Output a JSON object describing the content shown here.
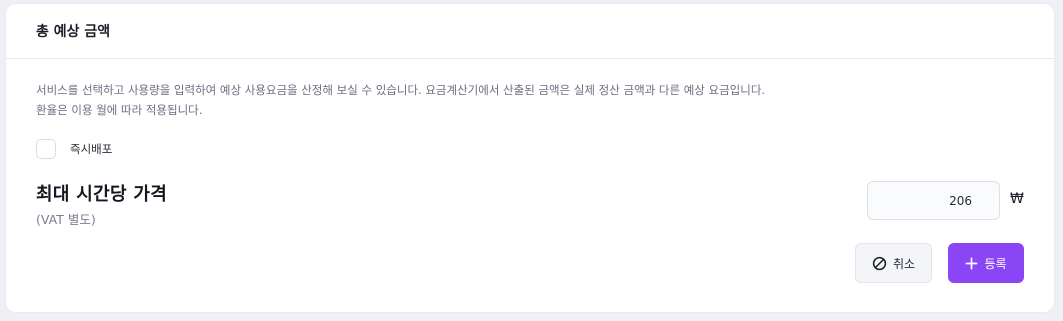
{
  "card": {
    "title": "총 예상 금액"
  },
  "description": {
    "line1": "서비스를 선택하고 사용량을 입력하여 예상 사용요금을 산정해 보실 수 있습니다. 요금계산기에서 산출된 금액은 실제 정산 금액과 다른 예상 요금입니다.",
    "line2": "환율은 이용 월에 따라 적용됩니다."
  },
  "instant_deploy": {
    "label": "즉시배포",
    "checked": false
  },
  "price": {
    "title": "최대 시간당 가격",
    "subtitle": "(VAT 별도)",
    "value": "206",
    "currency": "₩"
  },
  "actions": {
    "cancel_label": "취소",
    "cancel_icon": "ban-icon",
    "register_label": "등록",
    "register_icon": "plus-icon"
  },
  "colors": {
    "accent": "#8a45f5",
    "background": "#eef0f5"
  }
}
